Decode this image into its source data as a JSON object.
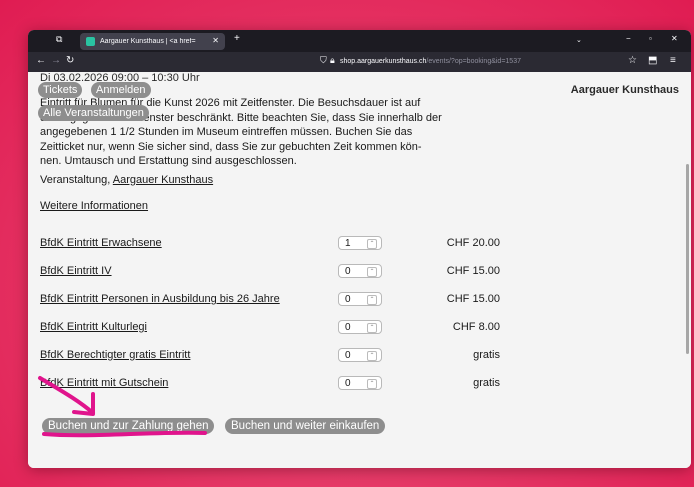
{
  "browser": {
    "tab_title": "Aargauer Kunsthaus | <a href=",
    "url_host": "shop.aargauerkunsthaus.ch",
    "url_path": "/events/?op=booking&id=1537"
  },
  "page": {
    "brand": "Aargauer Kunsthaus",
    "datetime": "Di 03.02.2026 09:00 – 10:30 Uhr",
    "nav": [
      "Tickets",
      "Anmelden",
      "Alle Veranstaltungen"
    ],
    "description_lines": [
      "Eintritt für Blumen für die Kunst 2026 mit Zeitfenster. Die Besuchsdauer ist auf",
      "die angegebene Zeitfenster beschränkt. Bitte beachten Sie, dass Sie innerhalb der",
      "angegebenen 1 1/2 Stunden im Museum eintreffen müssen. Buchen Sie das",
      "Zeitticket nur, wenn Sie sicher sind, dass Sie zur gebuchten Zeit kommen kön-",
      "nen. Umtausch und Erstattung sind ausgeschlossen."
    ],
    "venue_prefix": "Veranstaltung,",
    "venue_link": "Aargauer Kunsthaus",
    "more_info": "Weitere Informationen",
    "tickets": [
      {
        "label": "BfdK Eintritt Erwachsene",
        "qty": "1",
        "price": "CHF 20.00"
      },
      {
        "label": "BfdK Eintritt IV",
        "qty": "0",
        "price": "CHF 15.00"
      },
      {
        "label": "BfdK Eintritt Personen in Ausbildung bis 26 Jahre",
        "qty": "0",
        "price": "CHF 15.00"
      },
      {
        "label": "BfdK Eintritt Kulturlegi",
        "qty": "0",
        "price": "CHF 8.00"
      },
      {
        "label": "BfdK Berechtigter gratis Eintritt",
        "qty": "0",
        "price": "gratis"
      },
      {
        "label": "BfdK Eintritt mit Gutschein",
        "qty": "0",
        "price": "gratis"
      }
    ],
    "buttons": {
      "checkout": "Buchen und zur Zahlung gehen",
      "continue": "Buchen und weiter einkaufen"
    }
  },
  "colors": {
    "background": "#e8205a",
    "annotation": "#e0148c",
    "pill": "#8e8e8e"
  }
}
